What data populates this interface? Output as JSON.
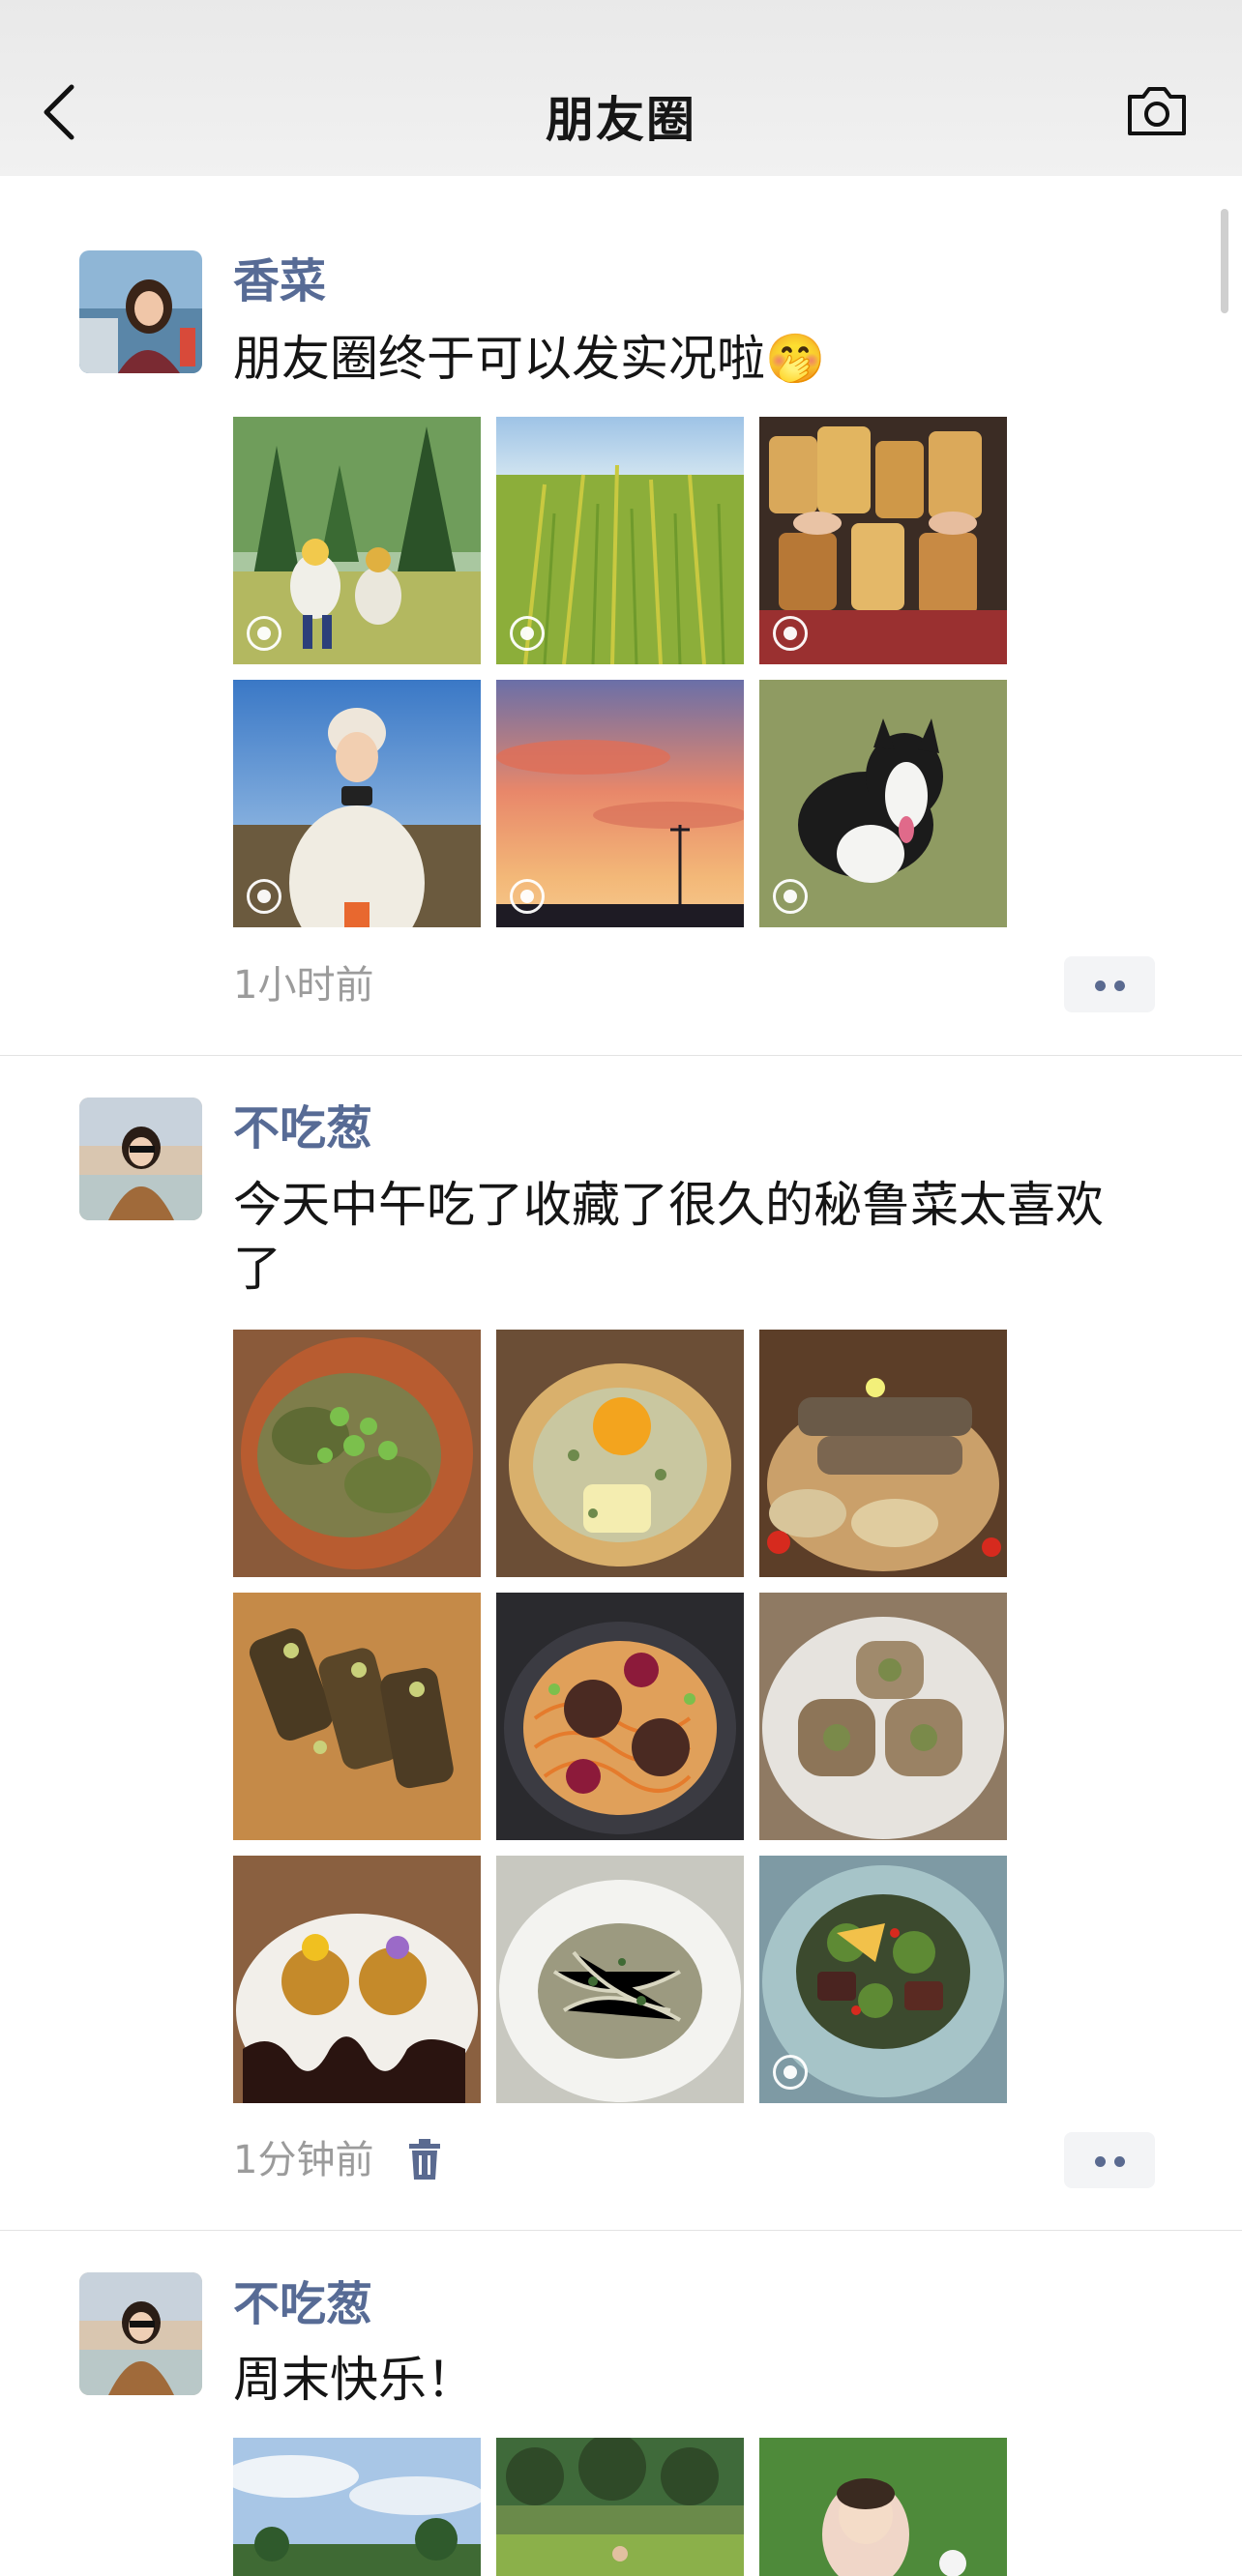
{
  "nav": {
    "title": "朋友圈",
    "back_icon": "chevron-left-icon",
    "camera_icon": "camera-icon"
  },
  "posts": [
    {
      "name": "香菜",
      "text": "朋友圈终于可以发实况啦🤭",
      "time": "1小时前",
      "photos": 6,
      "live_marks": [
        true,
        true,
        true,
        true,
        true,
        true
      ]
    },
    {
      "name": "不吃葱",
      "text": "今天中午吃了收藏了很久的秘鲁菜太喜欢了",
      "time": "1分钟前",
      "photos": 9,
      "live_marks": [
        false,
        false,
        false,
        false,
        false,
        false,
        false,
        false,
        true
      ],
      "has_delete": true
    },
    {
      "name": "不吃葱",
      "text": "周末快乐！",
      "photos_visible": 3
    }
  ],
  "colors": {
    "name_link": "#576b95",
    "time_gray": "#9b9b9b",
    "nav_bg": "#ededed"
  }
}
